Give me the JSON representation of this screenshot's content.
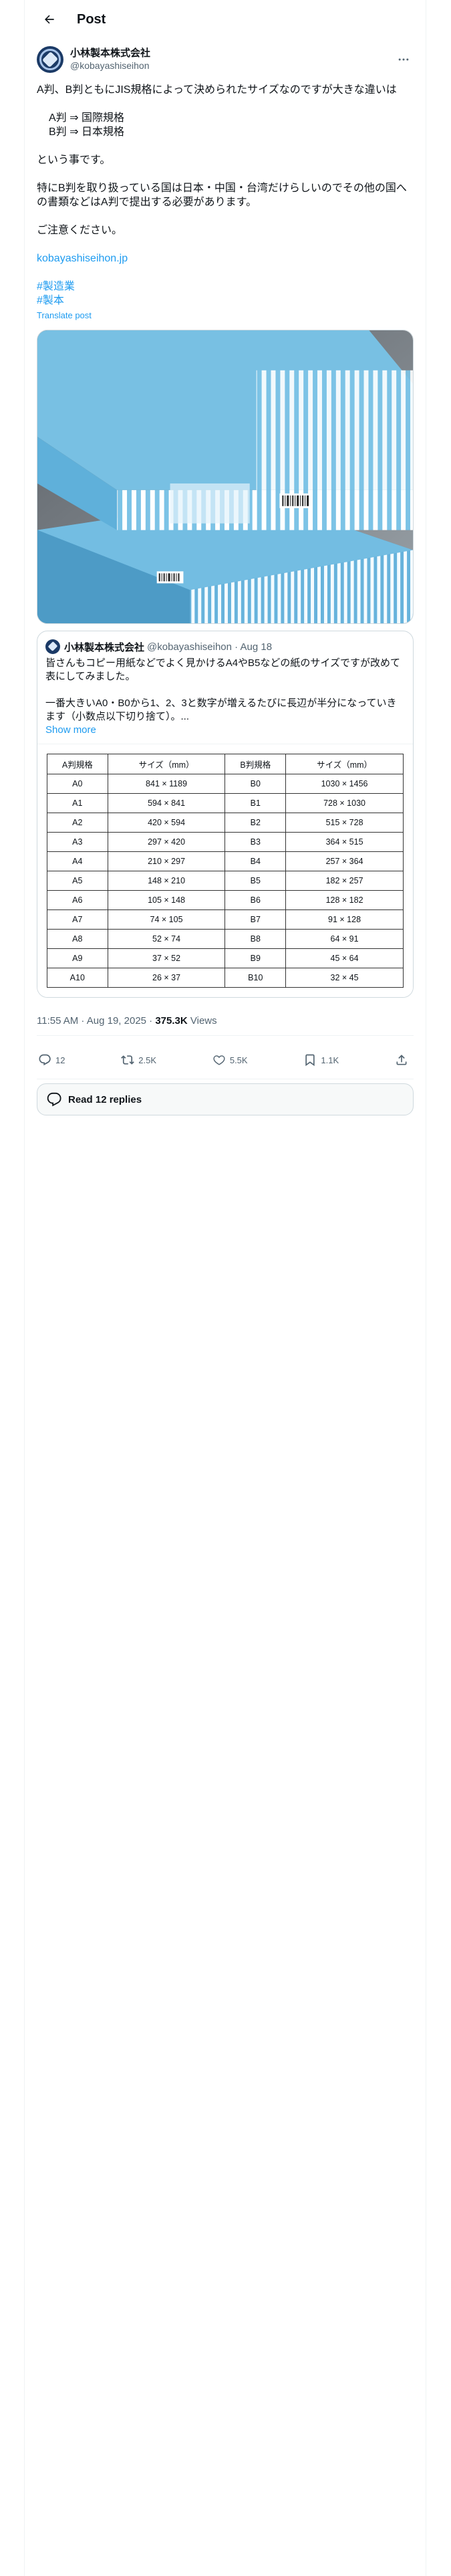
{
  "header": {
    "title": "Post"
  },
  "author": {
    "display_name": "小林製本株式会社",
    "handle": "@kobayashiseihon"
  },
  "post": {
    "line1": "A判、B判ともにJIS規格によって決められたサイズなのですが大きな違いは",
    "line2": "A判 ⇒ 国際規格",
    "line3": "B判 ⇒ 日本規格",
    "line4": "という事です。",
    "line5": "特にB判を取り扱っている国は日本・中国・台湾だけらしいのでその他の国への書類などはA判で提出する必要があります。",
    "line6": "ご注意ください。",
    "link": "kobayashiseihon.jp",
    "hashtag1": "#製造業",
    "hashtag2": "#製本",
    "translate": "Translate post"
  },
  "quote": {
    "display_name": "小林製本株式会社",
    "meta": "@kobayashiseihon · Aug 18",
    "text1": "皆さんもコピー用紙などでよく見かけるA4やB5などの紙のサイズですが改めて表にしてみました。",
    "text2": "一番大きいA0・B0から1、2、3と数字が増えるたびに長辺が半分になっていきます（小数点以下切り捨て）。...",
    "show_more": "Show more",
    "table": {
      "headers": [
        "A判規格",
        "サイズ（mm）",
        "B判規格",
        "サイズ（mm）"
      ],
      "rows": [
        [
          "A0",
          "841 × 1189",
          "B0",
          "1030 × 1456"
        ],
        [
          "A1",
          "594 × 841",
          "B1",
          "728 × 1030"
        ],
        [
          "A2",
          "420 × 594",
          "B2",
          "515 × 728"
        ],
        [
          "A3",
          "297 × 420",
          "B3",
          "364 × 515"
        ],
        [
          "A4",
          "210 × 297",
          "B4",
          "257 × 364"
        ],
        [
          "A5",
          "148 × 210",
          "B5",
          "182 × 257"
        ],
        [
          "A6",
          "105 × 148",
          "B6",
          "128 × 182"
        ],
        [
          "A7",
          "74 × 105",
          "B7",
          "91 × 128"
        ],
        [
          "A8",
          "52 × 74",
          "B8",
          "64 × 91"
        ],
        [
          "A9",
          "37 × 52",
          "B9",
          "45 × 64"
        ],
        [
          "A10",
          "26 × 37",
          "B10",
          "32 × 45"
        ]
      ]
    }
  },
  "meta": {
    "time": "11:55 AM · Aug 19, 2025 · ",
    "views": "375.3K",
    "views_label": " Views"
  },
  "actions": {
    "replies": "12",
    "reposts": "2.5K",
    "likes": "5.5K",
    "bookmarks": "1.1K"
  },
  "read_replies": "Read 12 replies",
  "colors": {
    "accent": "#1d9bf0",
    "muted": "#536471",
    "paper_blue": "#6ab9e0"
  }
}
